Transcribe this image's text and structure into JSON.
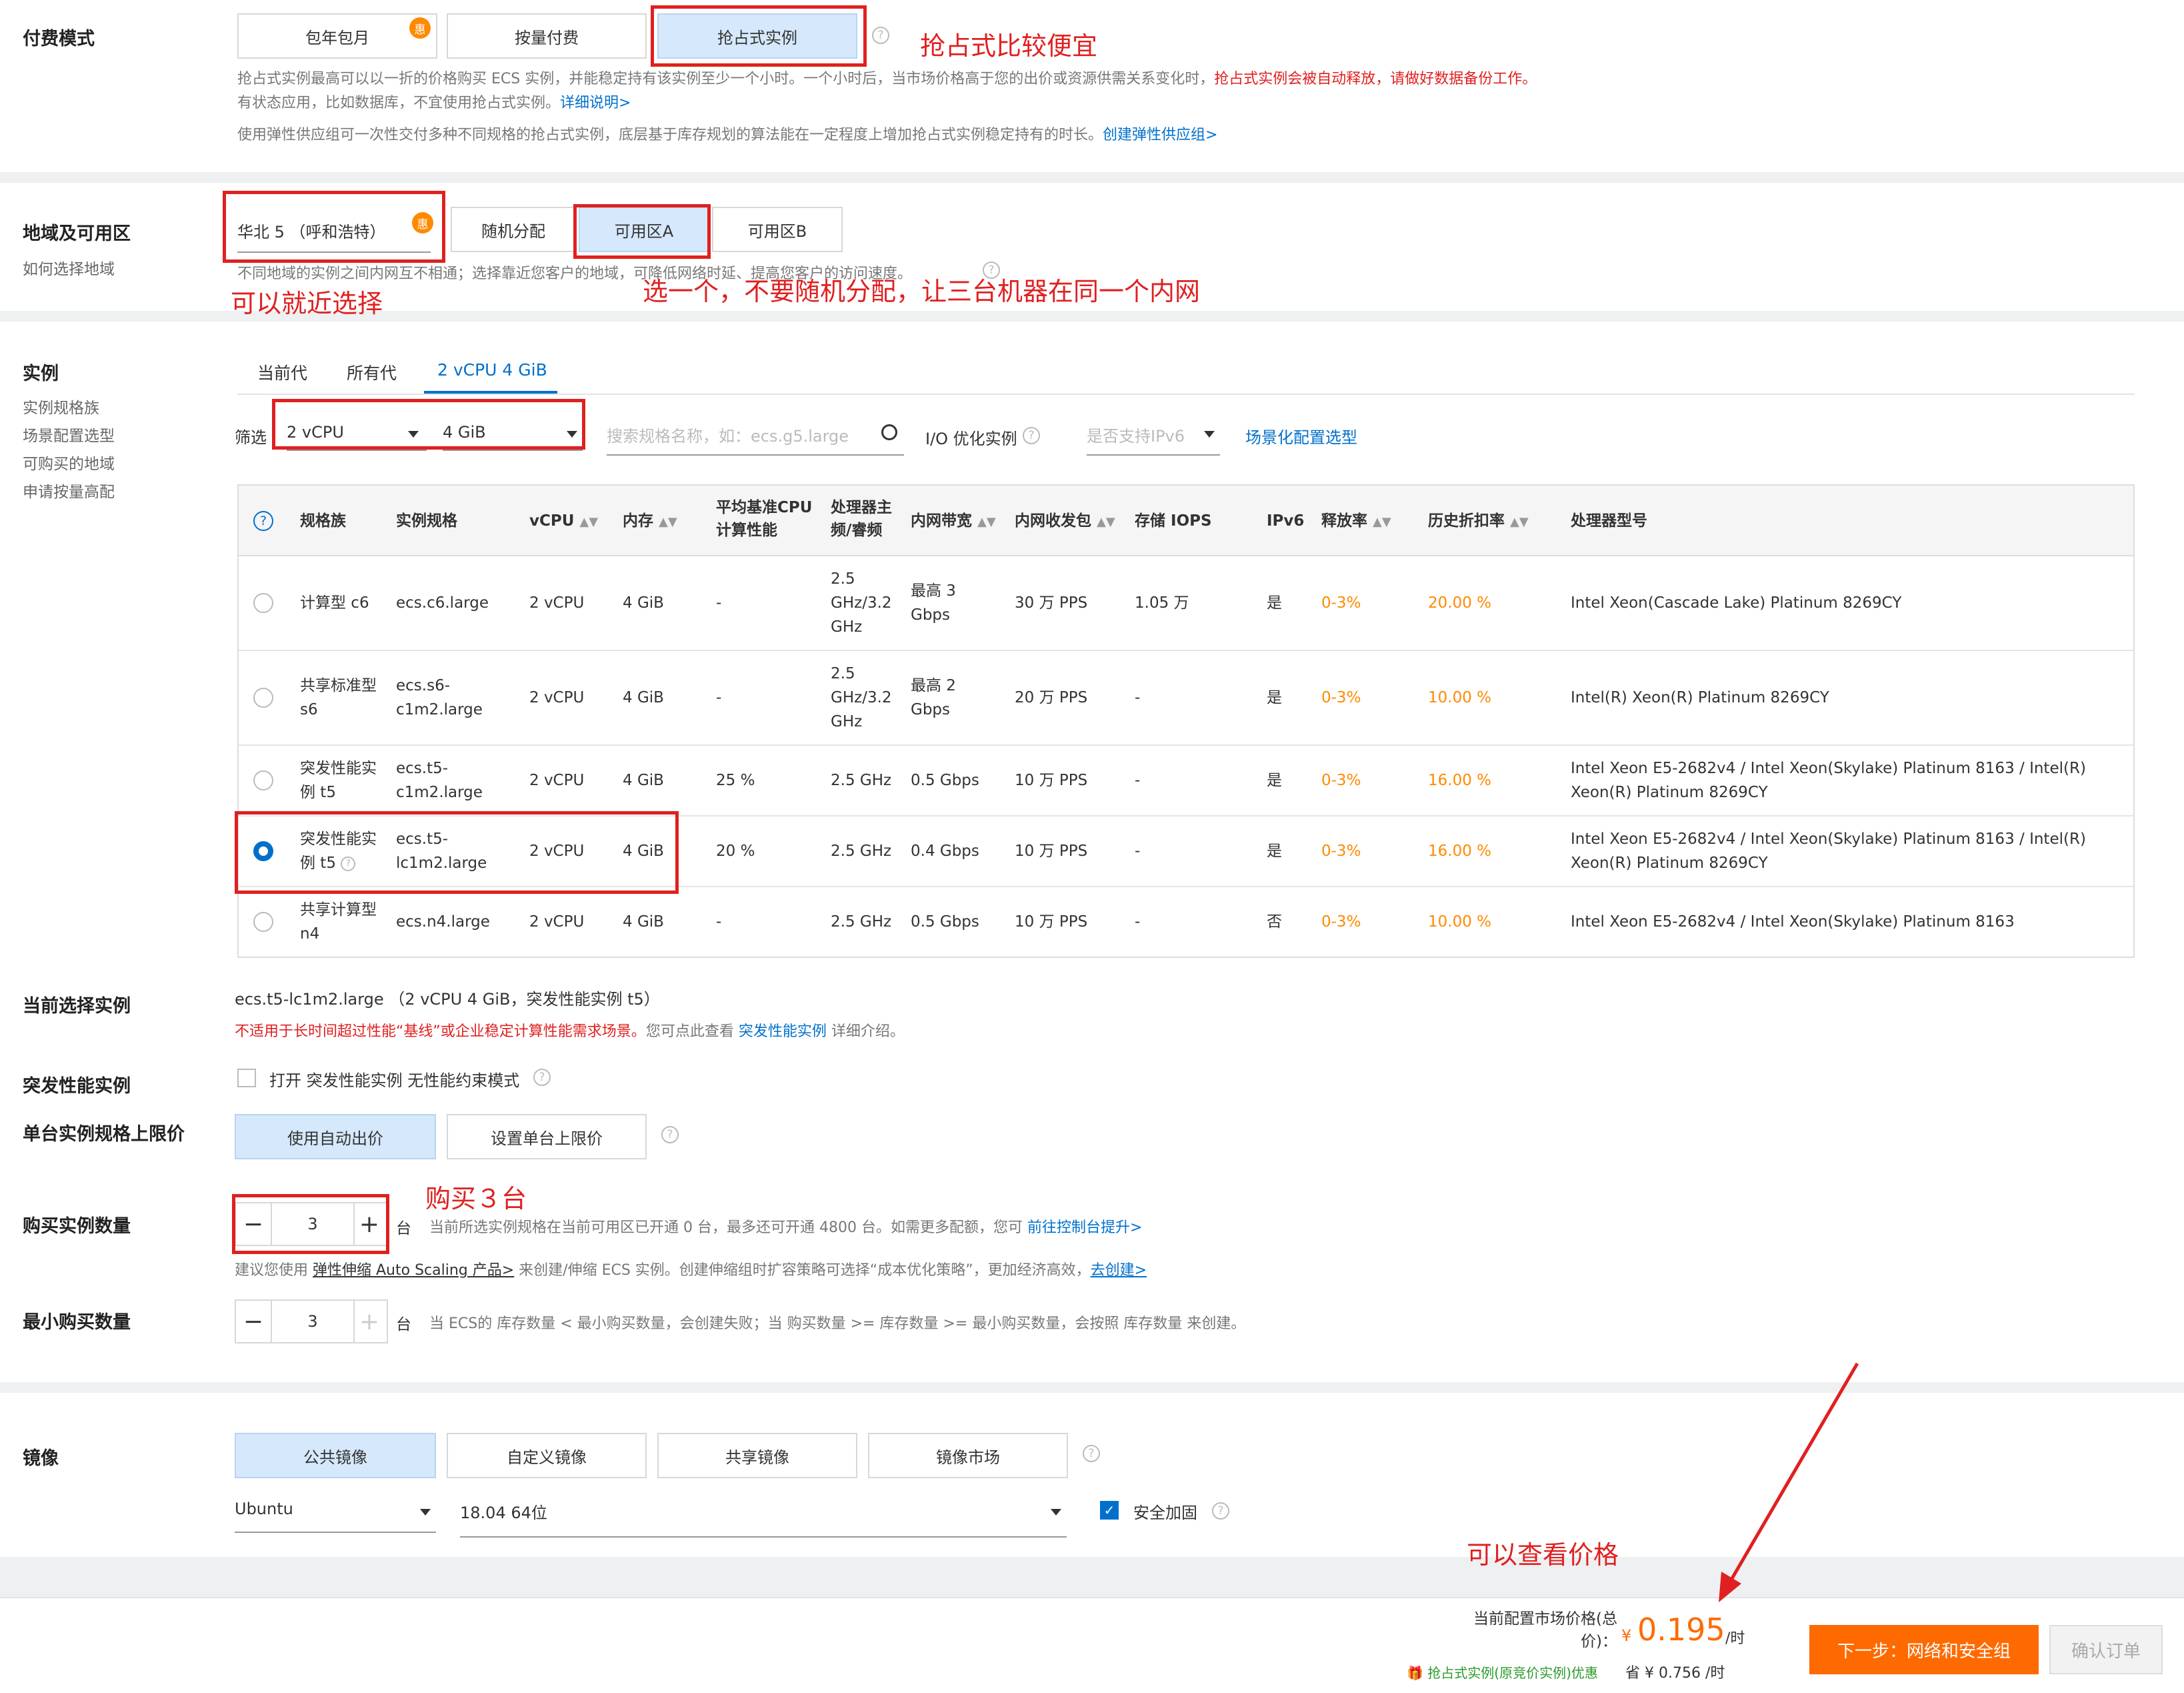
{
  "payment": {
    "label": "付费模式",
    "options": [
      "包年包月",
      "按量付费",
      "抢占式实例"
    ],
    "badge": "惠",
    "desc1_part1": "抢占式实例最高可以以一折的价格购买 ECS 实例，并能稳定持有该实例至少一个小时。一个小时后，当市场价格高于您的出价或资源供需关系变化时，",
    "desc1_red": "抢占式实例会被自动释放，请做好数据备份工作。",
    "desc2": "有状态应用，比如数据库，不宜使用抢占式实例。",
    "desc2_link": "详细说明>",
    "desc3": "使用弹性供应组可一次性交付多种不同规格的抢占式实例，底层基于库存规划的算法能在一定程度上增加抢占式实例稳定持有的时长。",
    "desc3_link": "创建弹性供应组>"
  },
  "region": {
    "label": "地域及可用区",
    "sub": "如何选择地域",
    "selected_region": "华北 5 （呼和浩特）",
    "zones": [
      "随机分配",
      "可用区A",
      "可用区B"
    ],
    "hint": "不同地域的实例之间内网互不相通；选择靠近您客户的地域，可降低网络时延、提高您客户的访问速度。"
  },
  "instance": {
    "label": "实例",
    "side_links": [
      "实例规格族",
      "场景配置选型",
      "可购买的地域",
      "申请按量高配"
    ],
    "tabs": [
      "当前代",
      "所有代",
      "2 vCPU 4 GiB"
    ],
    "filter_label": "筛选",
    "cpu_filter": "2 vCPU",
    "mem_filter": "4 GiB",
    "search_placeholder": "搜索规格名称，如：ecs.g5.large",
    "io_label": "I/O 优化实例",
    "ipv6_filter": "是否支持IPv6",
    "scene_link": "场景化配置选型",
    "headers": {
      "family": "规格族",
      "spec": "实例规格",
      "vcpu": "vCPU",
      "mem": "内存",
      "baseline_1": "平均基准CPU",
      "baseline_2": "计算性能",
      "freq_1": "处理器主",
      "freq_2": "频/睿频",
      "bw": "内网带宽",
      "pps": "内网收发包",
      "iops": "存储 IOPS",
      "ipv6": "IPv6",
      "release": "释放率",
      "discount": "历史折扣率",
      "cpu_model": "处理器型号"
    },
    "rows": [
      {
        "family_1": "计算型 c6",
        "family_2": "",
        "spec_1": "ecs.c6.large",
        "spec_2": "",
        "vcpu": "2 vCPU",
        "mem": "4 GiB",
        "baseline": "-",
        "freq_1": "2.5",
        "freq_2": "GHz/3.2",
        "freq_3": "GHz",
        "bw_1": "最高 3",
        "bw_2": "Gbps",
        "pps": "30 万 PPS",
        "iops": "1.05 万",
        "ipv6": "是",
        "release": "0-3%",
        "discount": "20.00 %",
        "cpu_1": "Intel Xeon(Cascade Lake) Platinum 8269CY",
        "cpu_2": ""
      },
      {
        "family_1": "共享标准型",
        "family_2": "s6",
        "spec_1": "ecs.s6-",
        "spec_2": "c1m2.large",
        "vcpu": "2 vCPU",
        "mem": "4 GiB",
        "baseline": "-",
        "freq_1": "2.5",
        "freq_2": "GHz/3.2",
        "freq_3": "GHz",
        "bw_1": "最高 2",
        "bw_2": "Gbps",
        "pps": "20 万 PPS",
        "iops": "-",
        "ipv6": "是",
        "release": "0-3%",
        "discount": "10.00 %",
        "cpu_1": "Intel(R) Xeon(R) Platinum 8269CY",
        "cpu_2": ""
      },
      {
        "family_1": "突发性能实",
        "family_2": "例 t5",
        "spec_1": "ecs.t5-",
        "spec_2": "c1m2.large",
        "vcpu": "2 vCPU",
        "mem": "4 GiB",
        "baseline": "25 %",
        "freq_1": "2.5 GHz",
        "freq_2": "",
        "freq_3": "",
        "bw_1": "0.5 Gbps",
        "bw_2": "",
        "pps": "10 万 PPS",
        "iops": "-",
        "ipv6": "是",
        "release": "0-3%",
        "discount": "16.00 %",
        "cpu_1": "Intel Xeon E5-2682v4 / Intel Xeon(Skylake) Platinum 8163 / Intel(R)",
        "cpu_2": "Xeon(R) Platinum 8269CY"
      },
      {
        "family_1": "突发性能实",
        "family_2": "例 t5",
        "spec_1": "ecs.t5-",
        "spec_2": "lc1m2.large",
        "vcpu": "2 vCPU",
        "mem": "4 GiB",
        "baseline": "20 %",
        "freq_1": "2.5 GHz",
        "freq_2": "",
        "freq_3": "",
        "bw_1": "0.4 Gbps",
        "bw_2": "",
        "pps": "10 万 PPS",
        "iops": "-",
        "ipv6": "是",
        "release": "0-3%",
        "discount": "16.00 %",
        "cpu_1": "Intel Xeon E5-2682v4 / Intel Xeon(Skylake) Platinum 8163 / Intel(R)",
        "cpu_2": "Xeon(R) Platinum 8269CY"
      },
      {
        "family_1": "共享计算型",
        "family_2": "n4",
        "spec_1": "ecs.n4.large",
        "spec_2": "",
        "vcpu": "2 vCPU",
        "mem": "4 GiB",
        "baseline": "-",
        "freq_1": "2.5 GHz",
        "freq_2": "",
        "freq_3": "",
        "bw_1": "0.5 Gbps",
        "bw_2": "",
        "pps": "10 万 PPS",
        "iops": "-",
        "ipv6": "否",
        "release": "0-3%",
        "discount": "10.00 %",
        "cpu_1": "Intel Xeon E5-2682v4 / Intel Xeon(Skylake) Platinum 8163",
        "cpu_2": ""
      }
    ]
  },
  "current": {
    "label": "当前选择实例",
    "value": "ecs.t5-lc1m2.large （2 vCPU 4 GiB，突发性能实例 t5）",
    "warn_red": "不适用于长时间超过性能“基线”或企业稳定计算性能需求场景。",
    "warn_rest": "您可点此查看 ",
    "warn_link": "突发性能实例",
    "warn_tail": " 详细介绍。"
  },
  "burst": {
    "label": "突发性能实例",
    "checkbox_text": "打开 突发性能实例 无性能约束模式"
  },
  "price_limit": {
    "label": "单台实例规格上限价",
    "options": [
      "使用自动出价",
      "设置单台上限价"
    ]
  },
  "quantity": {
    "label": "购买实例数量",
    "value": "3",
    "unit": "台",
    "hint_1": "当前所选实例规格在当前可用区已开通 0 台，最多还可开通 4800 台。如需更多配额，您可 ",
    "hint_link": "前往控制台提升>",
    "hint_2a": "建议您使用 ",
    "hint_2_link": "弹性伸缩 Auto Scaling 产品>",
    "hint_2b": " 来创建/伸缩 ECS 实例。创建伸缩组时扩容策略可选择“成本优化策略”，更加经济高效，",
    "hint_2_link2": "去创建>"
  },
  "min_quantity": {
    "label": "最小购买数量",
    "value": "3",
    "unit": "台",
    "hint": "当 ECS的 库存数量 < 最小购买数量，会创建失败；当 购买数量 >= 库存数量 >= 最小购买数量，会按照 库存数量 来创建。"
  },
  "image": {
    "label": "镜像",
    "tabs": [
      "公共镜像",
      "自定义镜像",
      "共享镜像",
      "镜像市场"
    ],
    "os": "Ubuntu",
    "version": "18.04 64位",
    "security": "安全加固"
  },
  "footer": {
    "price_label_1": "当前配置市场价格(总",
    "price_label_2": "价)：",
    "currency": "¥",
    "price": "0.195",
    "per_hour": "/时",
    "promo": "抢占式实例(原竞价实例)优惠",
    "save_label": "省",
    "save_value": "¥ 0.756",
    "next_button": "下一步：网络和安全组",
    "confirm_button": "确认订单"
  },
  "annotations": {
    "a1": "抢占式比较便宜",
    "a2": "可以就近选择",
    "a3": "选一个，不要随机分配，让三台机器在同一个内网",
    "a4": "购买３台",
    "a5": "可以查看价格"
  },
  "colors": {
    "accent": "#0070cc",
    "orange": "#ff6a00",
    "annotation_red": "#e02020"
  }
}
